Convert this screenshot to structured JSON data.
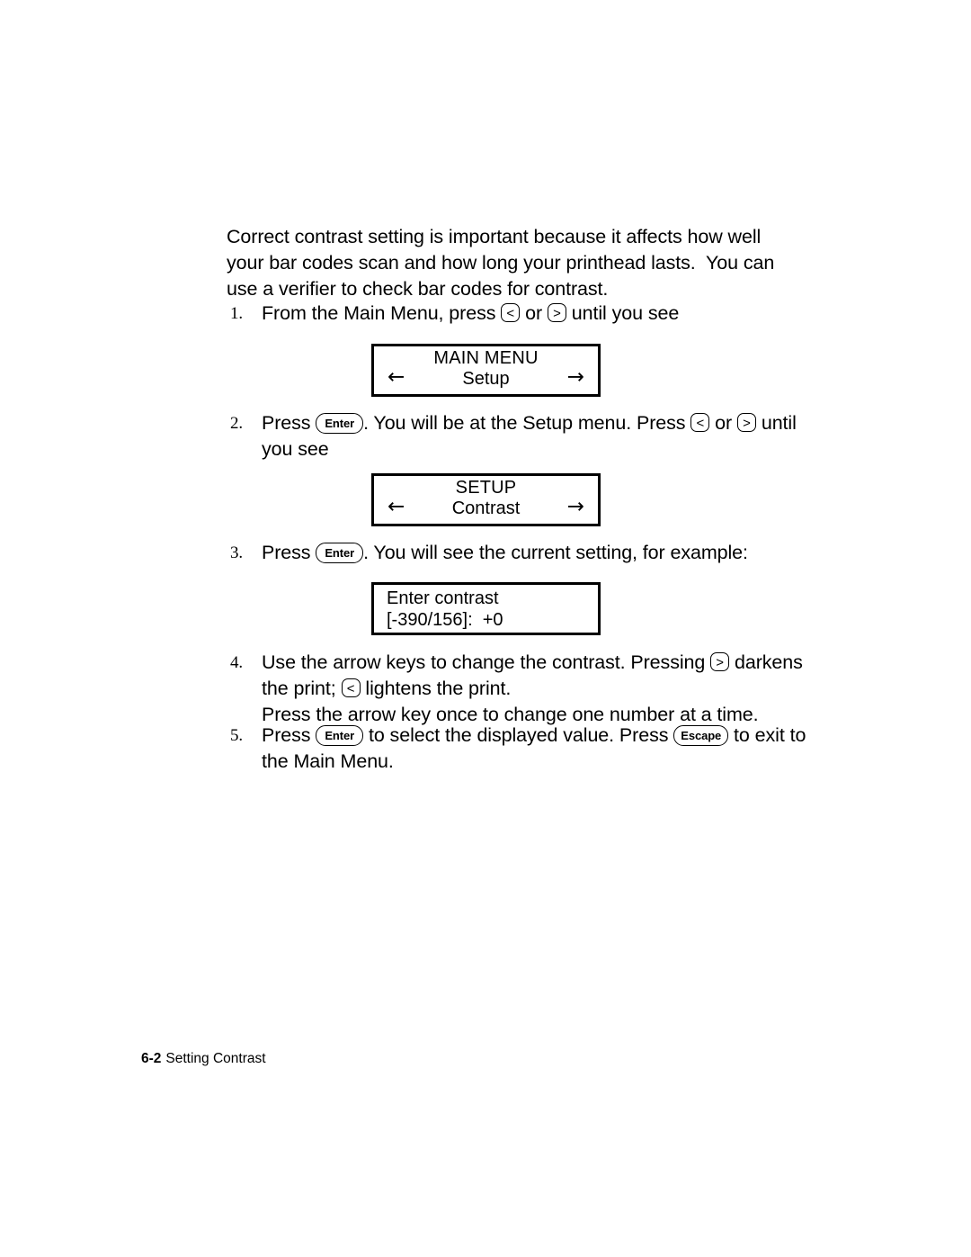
{
  "document": {
    "intro_paragraph": "Correct contrast setting is important because it affects how well your bar codes scan and how long your printhead lasts.  You can use a verifier to check bar codes for contrast.",
    "steps": [
      {
        "number": "1.",
        "text_before_key1": "From the Main Menu, press ",
        "key1": "<",
        "text_between": " or ",
        "key2": ">",
        "text_after": " until you see"
      },
      {
        "number": "2.",
        "text_before_key1": "Press ",
        "key1": "Enter",
        "text_between": ".  You will be at the Setup menu.  Press ",
        "key2": "<",
        "text_between2": " or ",
        "key3": ">",
        "text_after": " until you see"
      },
      {
        "number": "3.",
        "text_before_key1": "Press ",
        "key1": "Enter",
        "text_after": ".  You will see the current setting, for example:"
      },
      {
        "number": "4.",
        "text_before_key1": "Use the arrow keys to change the contrast.  Pressing ",
        "key1": ">",
        "text_between": " darkens the print; ",
        "key2": "<",
        "text_after": " lightens the print.",
        "extra_line": "Press the arrow key once to change one number at a time."
      },
      {
        "number": "5.",
        "text_before_key1": "Press ",
        "key1": "Enter",
        "text_between": " to select the displayed value.  Press ",
        "key2": "Escape",
        "text_after": " to exit to the Main Menu."
      }
    ],
    "lcd_displays": [
      {
        "name": "main-menu-display",
        "title": "MAIN MENU",
        "value": "Setup",
        "arrow_left": "←",
        "arrow_right": "→"
      },
      {
        "name": "setup-display",
        "title": "SETUP",
        "value": "Contrast",
        "arrow_left": "←",
        "arrow_right": "→"
      },
      {
        "name": "contrast-value-display",
        "line1": "Enter contrast",
        "line2": "[-390/156]:  +0"
      }
    ],
    "footer": {
      "page_number": "6-2",
      "section_title": "Setting Contrast"
    },
    "colors": {
      "text": "#000000",
      "background": "#ffffff",
      "border": "#000000"
    }
  }
}
